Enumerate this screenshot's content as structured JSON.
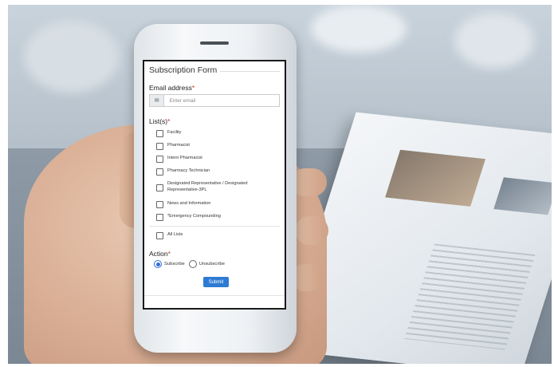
{
  "form": {
    "title": "Subscription Form",
    "email": {
      "label": "Email address",
      "required_mark": "*",
      "placeholder": "Enter email",
      "icon": "envelope-icon"
    },
    "lists": {
      "label": "List(s)",
      "required_mark": "*",
      "items": [
        {
          "label": "Facility",
          "checked": false
        },
        {
          "label": "Pharmacist",
          "checked": false
        },
        {
          "label": "Intern Pharmacist",
          "checked": false
        },
        {
          "label": "Pharmacy Technician",
          "checked": false
        },
        {
          "label": "Designated Representative / Designated Representative-3PL",
          "checked": false
        },
        {
          "label": "News and Information",
          "checked": false
        },
        {
          "label": "*Emergency Compounding",
          "checked": false
        }
      ],
      "all_lists_label": "All Lists"
    },
    "action": {
      "label": "Action",
      "required_mark": "*",
      "options": [
        {
          "label": "Subscribe",
          "selected": true
        },
        {
          "label": "Unsubscribe",
          "selected": false
        }
      ]
    },
    "submit_label": "Submit"
  },
  "colors": {
    "accent": "#2f7bd4",
    "required": "#c0392b"
  }
}
